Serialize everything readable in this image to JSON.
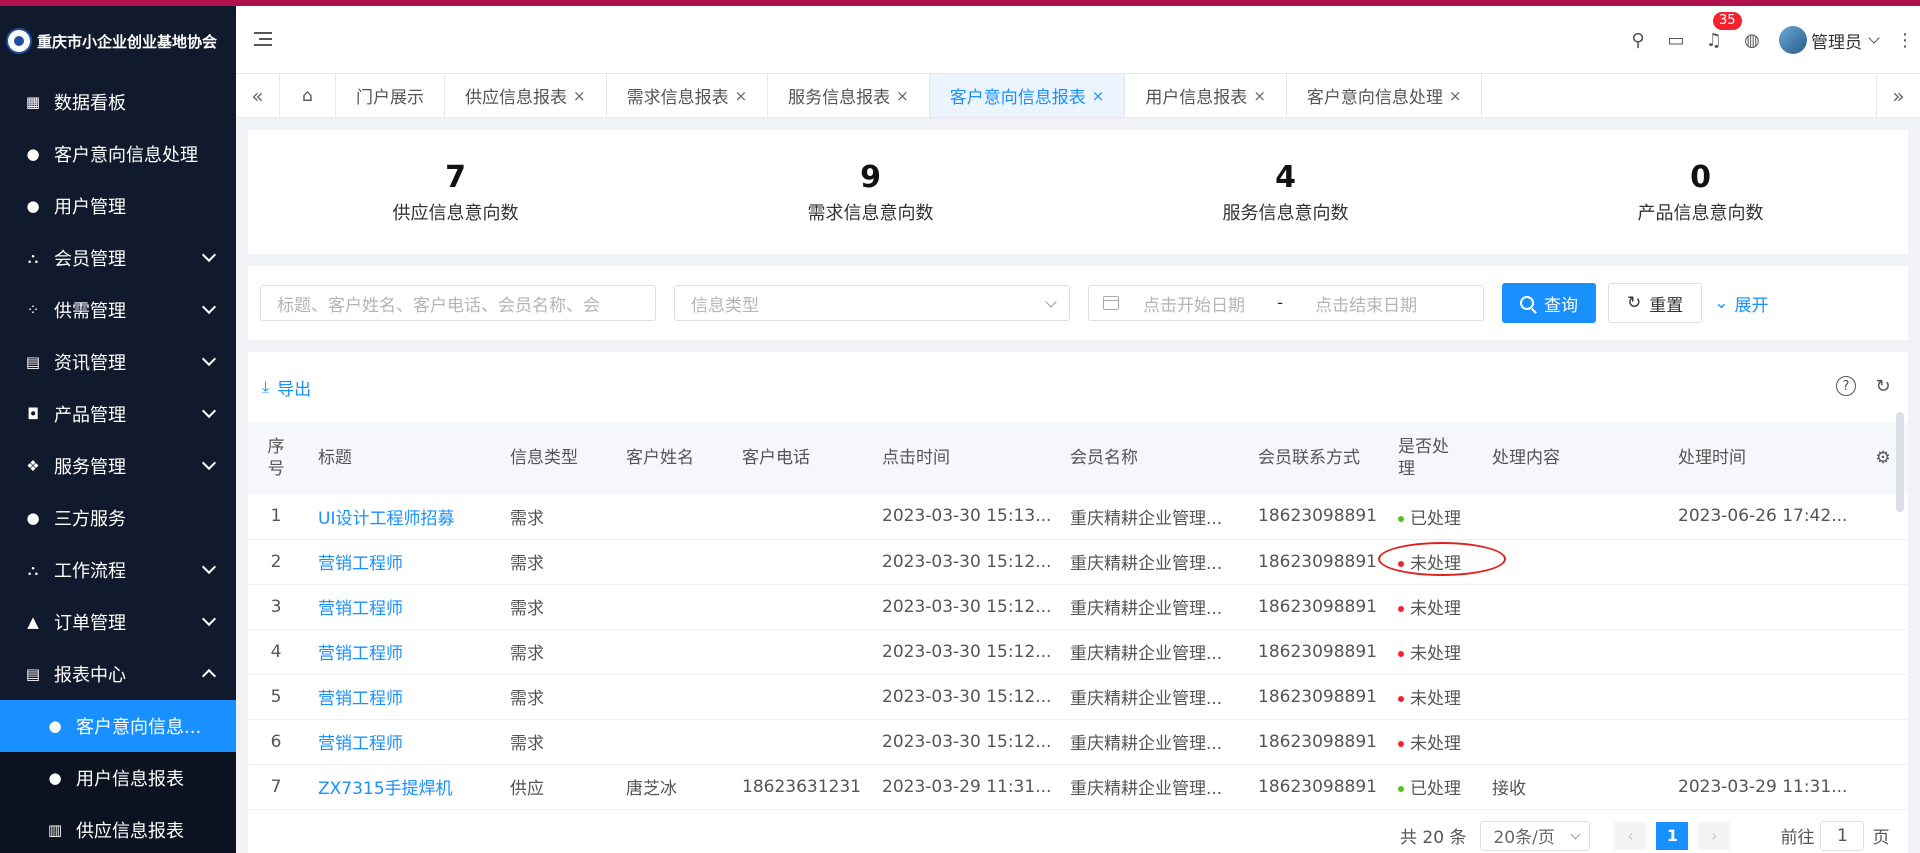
{
  "brand": {
    "name": "重庆市小企业创业基地协会"
  },
  "colors": {
    "primary": "#1890ff",
    "sidebar_bg": "#111a2c",
    "accent_bar": "#b0124f",
    "processed": "#52c41a",
    "unprocessed": "#f5222d"
  },
  "sidebar": {
    "items": [
      {
        "label": "数据看板",
        "icon": "dashboard-icon"
      },
      {
        "label": "客户意向信息处理",
        "icon": "user-icon"
      },
      {
        "label": "用户管理",
        "icon": "user-icon"
      },
      {
        "label": "会员管理",
        "icon": "members-icon"
      },
      {
        "label": "供需管理",
        "icon": "grid-icon"
      },
      {
        "label": "资讯管理",
        "icon": "document-icon"
      },
      {
        "label": "产品管理",
        "icon": "product-icon"
      },
      {
        "label": "服务管理",
        "icon": "apps-icon"
      },
      {
        "label": "三方服务",
        "icon": "user-icon"
      },
      {
        "label": "工作流程",
        "icon": "flow-icon"
      },
      {
        "label": "订单管理",
        "icon": "triangle-icon"
      },
      {
        "label": "报表中心",
        "icon": "report-icon"
      }
    ],
    "submenu": [
      {
        "label": "客户意向信息...",
        "icon": "user-icon"
      },
      {
        "label": "用户信息报表",
        "icon": "user-icon"
      },
      {
        "label": "供应信息报表",
        "icon": "supply-icon"
      }
    ]
  },
  "header": {
    "badge_count": "35",
    "username": "管理员"
  },
  "tabs": [
    {
      "label": "门户展示"
    },
    {
      "label": "供应信息报表"
    },
    {
      "label": "需求信息报表"
    },
    {
      "label": "服务信息报表"
    },
    {
      "label": "客户意向信息报表"
    },
    {
      "label": "用户信息报表"
    },
    {
      "label": "客户意向信息处理"
    }
  ],
  "stats": [
    {
      "value": "7",
      "label": "供应信息意向数"
    },
    {
      "value": "9",
      "label": "需求信息意向数"
    },
    {
      "value": "4",
      "label": "服务信息意向数"
    },
    {
      "value": "0",
      "label": "产品信息意向数"
    }
  ],
  "filter": {
    "search_placeholder": "标题、客户姓名、客户电话、会员名称、会",
    "type_placeholder": "信息类型",
    "start_placeholder": "点击开始日期",
    "date_sep": "-",
    "end_placeholder": "点击结束日期",
    "query_label": "查询",
    "reset_label": "重置",
    "expand_label": "展开"
  },
  "toolbar": {
    "export_label": "导出"
  },
  "table": {
    "columns": [
      "序号",
      "标题",
      "信息类型",
      "客户姓名",
      "客户电话",
      "点击时间",
      "会员名称",
      "会员联系方式",
      "是否处理",
      "处理内容",
      "处理时间"
    ],
    "rows": [
      {
        "idx": "1",
        "title": "UI设计工程师招募",
        "type": "需求",
        "cname": "",
        "cphone": "",
        "click_time": "2023-03-30 15:13...",
        "member": "重庆精耕企业管理...",
        "mphone": "18623098891",
        "status": "已处理",
        "content": "",
        "handle_time": "2023-06-26 17:42..."
      },
      {
        "idx": "2",
        "title": "营销工程师",
        "type": "需求",
        "cname": "",
        "cphone": "",
        "click_time": "2023-03-30 15:12...",
        "member": "重庆精耕企业管理...",
        "mphone": "18623098891",
        "status": "未处理",
        "content": "",
        "handle_time": ""
      },
      {
        "idx": "3",
        "title": "营销工程师",
        "type": "需求",
        "cname": "",
        "cphone": "",
        "click_time": "2023-03-30 15:12...",
        "member": "重庆精耕企业管理...",
        "mphone": "18623098891",
        "status": "未处理",
        "content": "",
        "handle_time": ""
      },
      {
        "idx": "4",
        "title": "营销工程师",
        "type": "需求",
        "cname": "",
        "cphone": "",
        "click_time": "2023-03-30 15:12...",
        "member": "重庆精耕企业管理...",
        "mphone": "18623098891",
        "status": "未处理",
        "content": "",
        "handle_time": ""
      },
      {
        "idx": "5",
        "title": "营销工程师",
        "type": "需求",
        "cname": "",
        "cphone": "",
        "click_time": "2023-03-30 15:12...",
        "member": "重庆精耕企业管理...",
        "mphone": "18623098891",
        "status": "未处理",
        "content": "",
        "handle_time": ""
      },
      {
        "idx": "6",
        "title": "营销工程师",
        "type": "需求",
        "cname": "",
        "cphone": "",
        "click_time": "2023-03-30 15:12...",
        "member": "重庆精耕企业管理...",
        "mphone": "18623098891",
        "status": "未处理",
        "content": "",
        "handle_time": ""
      },
      {
        "idx": "7",
        "title": "ZX7315手提焊机",
        "type": "供应",
        "cname": "唐芝冰",
        "cphone": "18623631231",
        "click_time": "2023-03-29 11:31...",
        "member": "重庆精耕企业管理...",
        "mphone": "18623098891",
        "status": "已处理",
        "content": "接收",
        "handle_time": "2023-03-29 11:31..."
      }
    ]
  },
  "pagination": {
    "total": "共 20 条",
    "page_size": "20条/页",
    "current": "1",
    "goto_label": "前往",
    "goto_value": "1",
    "unit": "页"
  }
}
